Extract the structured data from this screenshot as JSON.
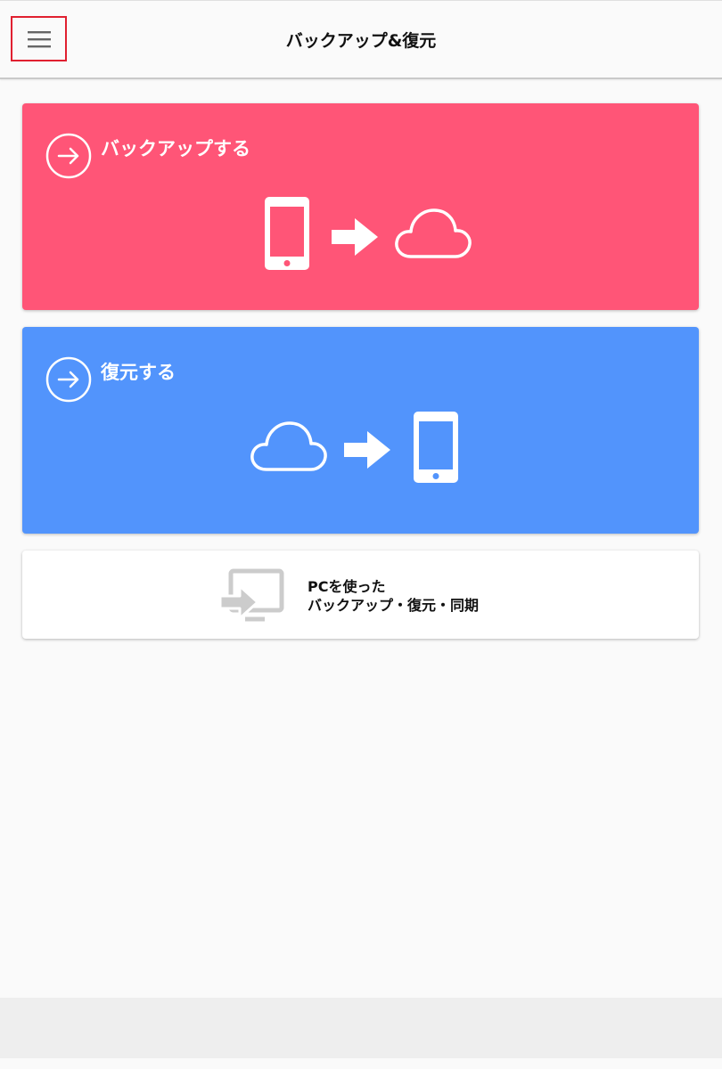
{
  "header": {
    "title": "バックアップ&復元",
    "menu_icon": "hamburger-menu-icon"
  },
  "cards": {
    "backup": {
      "label": "バックアップする",
      "color": "#ff5577",
      "icons": [
        "arrow-circle-right-icon",
        "smartphone-icon",
        "right-arrow-icon",
        "cloud-icon"
      ]
    },
    "restore": {
      "label": "復元する",
      "color": "#5294fc",
      "icons": [
        "arrow-circle-right-icon",
        "cloud-icon",
        "right-arrow-icon",
        "smartphone-icon"
      ]
    },
    "pc": {
      "line1": "PCを使った",
      "line2": "バックアップ・復元・同期",
      "icon": "cast-to-pc-icon"
    }
  }
}
